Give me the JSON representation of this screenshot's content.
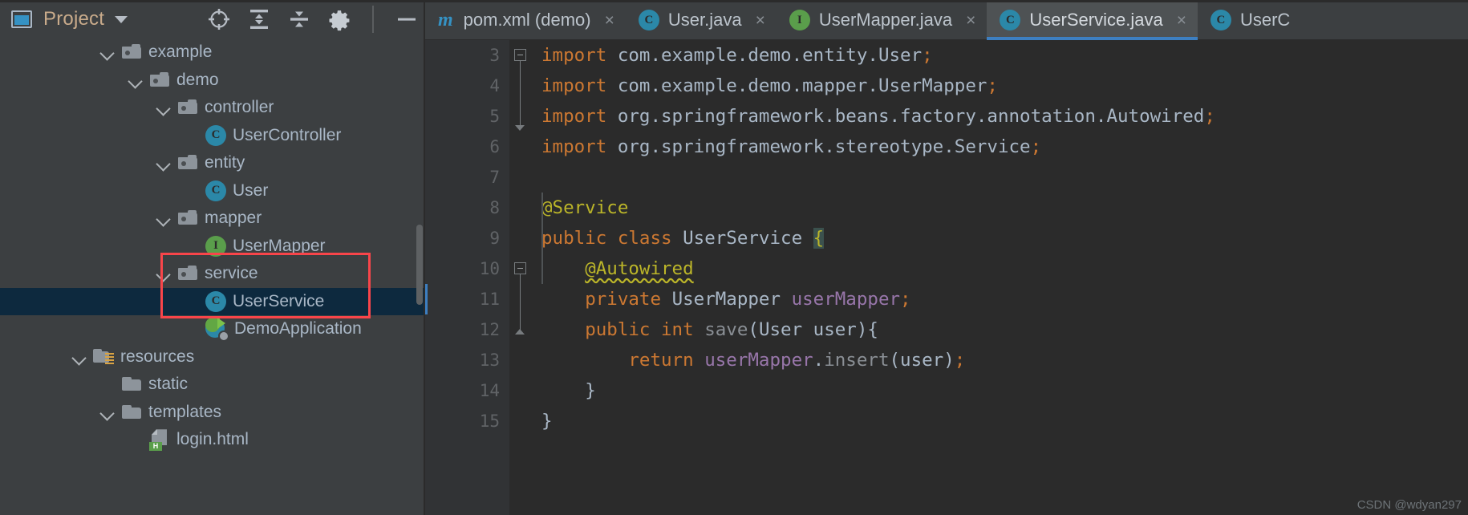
{
  "colors": {
    "accent": "#3d7fc1",
    "class_icon": "#2b88a8",
    "interface_icon": "#5a9e4b",
    "annotation": "#bbb529",
    "keyword": "#cc7832",
    "field": "#9876aa",
    "selection": "#0d293e",
    "annotation_box": "#f8454a",
    "panel_bg": "#3c3f41",
    "editor_bg": "#2b2b2b"
  },
  "tool_window": {
    "title": "Project",
    "window_icon": "project-window-icon",
    "dropdown_icon": "chevron-down-icon",
    "actions": [
      {
        "name": "select-opened-file-icon",
        "label": "Select Opened File"
      },
      {
        "name": "expand-all-icon",
        "label": "Expand All"
      },
      {
        "name": "collapse-all-icon",
        "label": "Collapse All"
      },
      {
        "name": "settings-gear-icon",
        "label": "Settings"
      },
      {
        "name": "hide-minimize-icon",
        "label": "Hide"
      }
    ]
  },
  "tree": [
    {
      "label": "example",
      "icon": "package-folder-icon",
      "indent": 3,
      "expanded": true,
      "selected": false
    },
    {
      "label": "demo",
      "icon": "package-folder-icon",
      "indent": 4,
      "expanded": true,
      "selected": false
    },
    {
      "label": "controller",
      "icon": "package-folder-icon",
      "indent": 5,
      "expanded": true,
      "selected": false
    },
    {
      "label": "UserController",
      "icon": "java-class-icon",
      "indent": 6,
      "expanded": null,
      "selected": false
    },
    {
      "label": "entity",
      "icon": "package-folder-icon",
      "indent": 5,
      "expanded": true,
      "selected": false
    },
    {
      "label": "User",
      "icon": "java-class-icon",
      "indent": 6,
      "expanded": null,
      "selected": false
    },
    {
      "label": "mapper",
      "icon": "package-folder-icon",
      "indent": 5,
      "expanded": true,
      "selected": false
    },
    {
      "label": "UserMapper",
      "icon": "java-interface-icon",
      "indent": 6,
      "expanded": null,
      "selected": false
    },
    {
      "label": "service",
      "icon": "package-folder-icon",
      "indent": 5,
      "expanded": true,
      "selected": false
    },
    {
      "label": "UserService",
      "icon": "java-class-icon",
      "indent": 6,
      "expanded": null,
      "selected": true
    },
    {
      "label": "DemoApplication",
      "icon": "spring-boot-app-icon",
      "indent": 6,
      "expanded": null,
      "selected": false
    },
    {
      "label": "resources",
      "icon": "resources-folder-icon",
      "indent": 2,
      "expanded": true,
      "selected": false
    },
    {
      "label": "static",
      "icon": "folder-icon",
      "indent": 3,
      "expanded": null,
      "selected": false
    },
    {
      "label": "templates",
      "icon": "folder-icon",
      "indent": 3,
      "expanded": true,
      "selected": false
    },
    {
      "label": "login.html",
      "icon": "html-file-icon",
      "indent": 4,
      "expanded": null,
      "selected": false
    }
  ],
  "tabs": [
    {
      "label": "pom.xml (demo)",
      "icon": "maven-icon",
      "active": false,
      "close": "×"
    },
    {
      "label": "User.java",
      "icon": "java-class-icon",
      "active": false,
      "close": "×"
    },
    {
      "label": "UserMapper.java",
      "icon": "java-interface-icon",
      "active": false,
      "close": "×"
    },
    {
      "label": "UserService.java",
      "icon": "java-class-icon",
      "active": true,
      "close": "×"
    },
    {
      "label": "UserC",
      "icon": "java-class-icon",
      "active": false,
      "close": ""
    }
  ],
  "editor": {
    "file": "UserService.java",
    "line_numbers": [
      "3",
      "4",
      "5",
      "6",
      "7",
      "8",
      "9",
      "10",
      "11",
      "12",
      "13",
      "14",
      "15"
    ],
    "lines": [
      "import com.example.demo.entity.User;",
      "import com.example.demo.mapper.UserMapper;",
      "import org.springframework.beans.factory.annotation.Autowired;",
      "import org.springframework.stereotype.Service;",
      "",
      "@Service",
      "public class UserService {",
      "    @Autowired",
      "    private UserMapper userMapper;",
      "    public int save(User user){",
      "        return userMapper.insert(user);",
      "    }",
      "}"
    ],
    "gutter_markers": [
      {
        "line": "9",
        "name": "spring-bean-gutter-icon"
      },
      {
        "line": "11",
        "name": "autowired-dependency-gutter-icon"
      }
    ]
  },
  "watermark": "CSDN @wdyan297"
}
